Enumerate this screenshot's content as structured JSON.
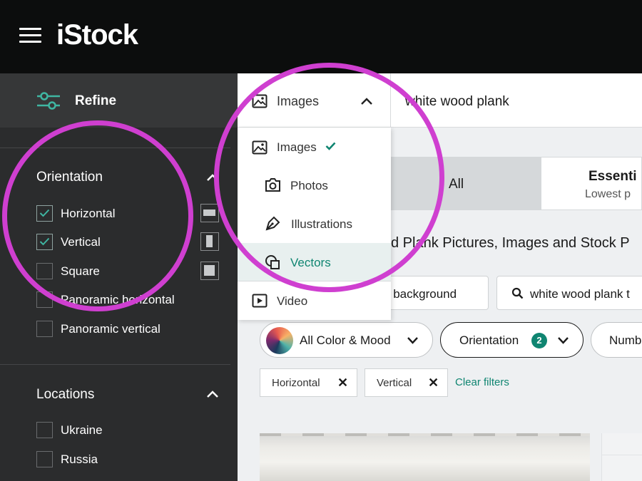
{
  "header": {
    "logo": "iStock"
  },
  "sidebar": {
    "refine_label": "Refine",
    "orientation": {
      "title": "Orientation",
      "options": [
        {
          "label": "Horizontal",
          "checked": true
        },
        {
          "label": "Vertical",
          "checked": true
        },
        {
          "label": "Square",
          "checked": false
        },
        {
          "label": "Panoramic horizontal",
          "checked": false
        },
        {
          "label": "Panoramic vertical",
          "checked": false
        }
      ]
    },
    "locations": {
      "title": "Locations",
      "options": [
        {
          "label": "Ukraine",
          "checked": false
        },
        {
          "label": "Russia",
          "checked": false
        }
      ]
    }
  },
  "search": {
    "media_type": "Images",
    "query": "white wood plank"
  },
  "media_dropdown": {
    "items": [
      {
        "label": "Images",
        "selected_check": true
      },
      {
        "label": "Photos"
      },
      {
        "label": "Illustrations"
      },
      {
        "label": "Vectors",
        "highlighted": true
      },
      {
        "label": "Video"
      }
    ]
  },
  "tabs": {
    "all": "All",
    "essentials_title": "Essenti",
    "essentials_sub": "Lowest p"
  },
  "results": {
    "heading": "d Plank Pictures, Images and Stock P"
  },
  "related_searches": [
    {
      "label": "k background"
    },
    {
      "label": "white wood plank t"
    }
  ],
  "filters": {
    "color_mood": "All Color & Mood",
    "orientation": "Orientation",
    "orientation_count": "2",
    "number": "Numb"
  },
  "active_filters": [
    {
      "label": "Horizontal"
    },
    {
      "label": "Vertical"
    }
  ],
  "clear_filters": "Clear filters",
  "colors": {
    "accent": "#0f8571",
    "highlight_circle": "#cf3fd0",
    "topbar": "#0c0d0d",
    "sidebar": "#2b2c2d"
  }
}
